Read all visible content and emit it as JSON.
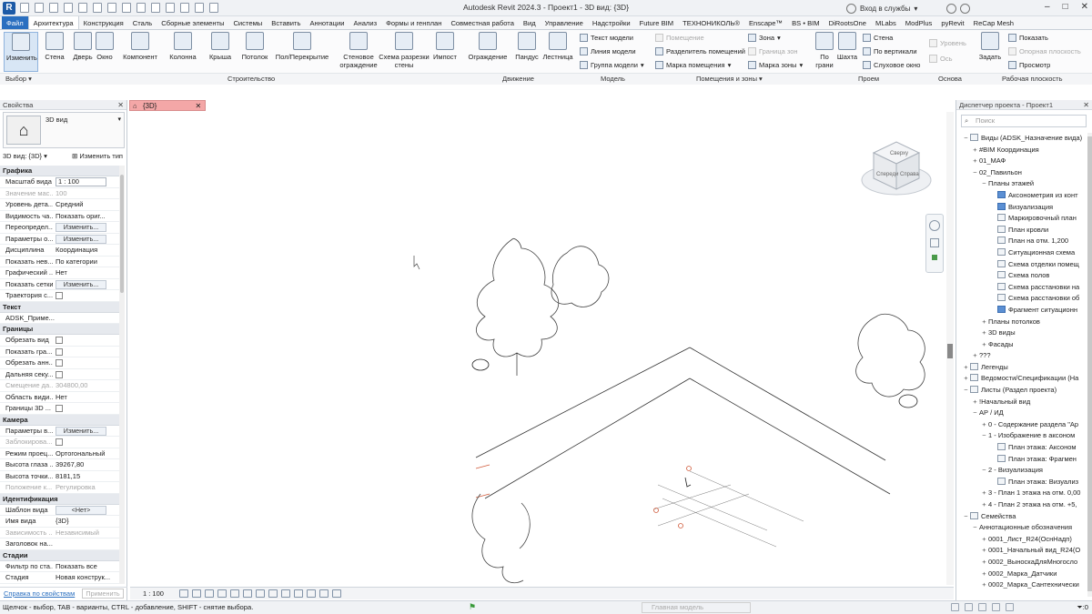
{
  "window": {
    "title": "Autodesk Revit 2024.3 - Проект1 - 3D вид: {3D}",
    "login": "Вход в службы",
    "app_logo": "R"
  },
  "tabs": [
    "Файл",
    "Архитектура",
    "Конструкция",
    "Сталь",
    "Сборные элементы",
    "Системы",
    "Вставить",
    "Аннотации",
    "Анализ",
    "Формы и генплан",
    "Совместная работа",
    "Вид",
    "Управление",
    "Надстройки",
    "Future BIM",
    "ТЕХНОНИКОЛЬ®",
    "Enscape™",
    "BS • BIM",
    "DiRootsOne",
    "MLabs",
    "ModPlus",
    "pyRevit",
    "ReCap Mesh"
  ],
  "ribbon": {
    "modify": "Изменить",
    "select": "Выбор",
    "build_buttons": [
      "Стена",
      "Дверь",
      "Окно",
      "Компонент",
      "Колонна",
      "Крыша",
      "Потолок",
      "Пол/Перекрытие",
      "Стеновое ограждение",
      "Схема разрезки стены",
      "Импост"
    ],
    "move_buttons": [
      "Ограждение",
      "Пандус",
      "Лестница"
    ],
    "model_items": [
      "Текст модели",
      "Линия модели",
      "Группа модели"
    ],
    "rooms_items": [
      "Помещение",
      "Разделитель помещений",
      "Марка помещения",
      "Зона",
      "Граница зон",
      "Марка зоны"
    ],
    "opening": {
      "face": "По грани",
      "shaft": "Шахта",
      "wall": "Стена",
      "vertical": "По вертикали",
      "dormer": "Слуховое окно"
    },
    "datum": {
      "level": "Уровень",
      "grid": "Ось"
    },
    "work_plane": {
      "set": "Задать",
      "show": "Показать",
      "ref_plane": "Опорная плоскость",
      "viewer": "Просмотр"
    },
    "panels": [
      "Выбор",
      "Строительство",
      "Движение",
      "Модель",
      "Помещения и зоны",
      "Проем",
      "Основа",
      "Рабочая плоскость"
    ]
  },
  "properties": {
    "title": "Свойства",
    "type_name": "3D вид",
    "selector": "3D вид: {3D}",
    "edit_type": "Изменить тип",
    "sections": [
      {
        "name": "Графика",
        "rows": [
          {
            "k": "Масштаб вида",
            "v": "1 : 100",
            "kind": "input"
          },
          {
            "k": "Значение мас...",
            "v": "100",
            "kind": "dim"
          },
          {
            "k": "Уровень дета...",
            "v": "Средний"
          },
          {
            "k": "Видимость ча...",
            "v": "Показать ориг..."
          },
          {
            "k": "Переопредел...",
            "v": "Изменить...",
            "kind": "button"
          },
          {
            "k": "Параметры о...",
            "v": "Изменить...",
            "kind": "button"
          },
          {
            "k": "Дисциплина",
            "v": "Координация"
          },
          {
            "k": "Показать нев...",
            "v": "По категории"
          },
          {
            "k": "Графический ...",
            "v": "Нет"
          },
          {
            "k": "Показать сетки",
            "v": "Изменить...",
            "kind": "button"
          },
          {
            "k": "Траектория с...",
            "v": "",
            "kind": "check"
          }
        ]
      },
      {
        "name": "Текст",
        "rows": [
          {
            "k": "ADSK_Приме...",
            "v": "",
            "kind": "full"
          }
        ]
      },
      {
        "name": "Границы",
        "rows": [
          {
            "k": "Обрезать вид",
            "v": "",
            "kind": "check"
          },
          {
            "k": "Показать гра...",
            "v": "",
            "kind": "check"
          },
          {
            "k": "Обрезать анн...",
            "v": "",
            "kind": "check"
          },
          {
            "k": "Дальняя секу...",
            "v": "",
            "kind": "check"
          },
          {
            "k": "Смещение да...",
            "v": "304800,00",
            "kind": "dim"
          },
          {
            "k": "Область види...",
            "v": "Нет"
          },
          {
            "k": "Границы 3D ...",
            "v": "",
            "kind": "check"
          }
        ]
      },
      {
        "name": "Камера",
        "rows": [
          {
            "k": "Параметры в...",
            "v": "Изменить...",
            "kind": "button"
          },
          {
            "k": "Заблокирова...",
            "v": "",
            "kind": "check",
            "dim": true
          },
          {
            "k": "Режим проец...",
            "v": "Ортогональный"
          },
          {
            "k": "Высота глаза ...",
            "v": "39267,80"
          },
          {
            "k": "Высота точки...",
            "v": "8181,15"
          },
          {
            "k": "Положение к...",
            "v": "Регулировка",
            "kind": "dim"
          }
        ]
      },
      {
        "name": "Идентификация",
        "rows": [
          {
            "k": "Шаблон вида",
            "v": "<Нет>",
            "kind": "button"
          },
          {
            "k": "Имя вида",
            "v": "{3D}"
          },
          {
            "k": "Зависимость ...",
            "v": "Независимый",
            "kind": "dim"
          },
          {
            "k": "Заголовок на...",
            "v": ""
          }
        ]
      },
      {
        "name": "Стадии",
        "rows": [
          {
            "k": "Фильтр по ста...",
            "v": "Показать все"
          },
          {
            "k": "Стадия",
            "v": "Новая конструк..."
          }
        ]
      }
    ],
    "help": "Справка по свойствам",
    "apply": "Применить"
  },
  "view_tab": {
    "label": "{3D}"
  },
  "view_control": {
    "scale": "1 : 100"
  },
  "viewcube": {
    "top": "Сверху",
    "front": "Спереди",
    "right": "Справа"
  },
  "browser": {
    "title": "Диспетчер проекта - Проект1",
    "search_placeholder": "Поиск",
    "items": [
      {
        "t": "Виды (ADSK_Назначение вида)",
        "lvl": 0,
        "tog": "−",
        "icon": "views-icon"
      },
      {
        "t": "#BIM Координация",
        "lvl": 1,
        "tog": "+"
      },
      {
        "t": "01_МАФ",
        "lvl": 1,
        "tog": "+"
      },
      {
        "t": "02_Павильон",
        "lvl": 1,
        "tog": "−"
      },
      {
        "t": "Планы этажей",
        "lvl": 2,
        "tog": "−"
      },
      {
        "t": "Аксонометрия из конт",
        "lvl": 3,
        "icon": "plan-icon",
        "blue": true
      },
      {
        "t": "Визуализация",
        "lvl": 3,
        "icon": "plan-icon",
        "blue": true
      },
      {
        "t": "Маркировочный план",
        "lvl": 3,
        "icon": "plan-icon"
      },
      {
        "t": "План кровли",
        "lvl": 3,
        "icon": "plan-icon"
      },
      {
        "t": "План на отм. 1,200",
        "lvl": 3,
        "icon": "plan-icon"
      },
      {
        "t": "Ситуационная схема",
        "lvl": 3,
        "icon": "plan-icon"
      },
      {
        "t": "Схема отделки помещ",
        "lvl": 3,
        "icon": "plan-icon"
      },
      {
        "t": "Схема полов",
        "lvl": 3,
        "icon": "plan-icon"
      },
      {
        "t": "Схема расстановки на",
        "lvl": 3,
        "icon": "plan-icon"
      },
      {
        "t": "Схема расстановки об",
        "lvl": 3,
        "icon": "plan-icon"
      },
      {
        "t": "Фрагмент ситуационн",
        "lvl": 3,
        "icon": "plan-icon",
        "blue": true
      },
      {
        "t": "Планы потолков",
        "lvl": 2,
        "tog": "+"
      },
      {
        "t": "3D виды",
        "lvl": 2,
        "tog": "+"
      },
      {
        "t": "Фасады",
        "lvl": 2,
        "tog": "+"
      },
      {
        "t": "???",
        "lvl": 1,
        "tog": "+"
      },
      {
        "t": "Легенды",
        "lvl": 0,
        "tog": "+",
        "icon": "legend-icon"
      },
      {
        "t": "Ведомости/Спецификации (На",
        "lvl": 0,
        "tog": "+",
        "icon": "schedule-icon"
      },
      {
        "t": "Листы (Раздел проекта)",
        "lvl": 0,
        "tog": "−",
        "icon": "sheet-icon"
      },
      {
        "t": "!Начальный вид",
        "lvl": 1,
        "tog": "+"
      },
      {
        "t": "АР / ИД",
        "lvl": 1,
        "tog": "−"
      },
      {
        "t": "0 - Содержание раздела \"Ар",
        "lvl": 2,
        "tog": "+"
      },
      {
        "t": "1 - Изображение в аксоном",
        "lvl": 2,
        "tog": "−"
      },
      {
        "t": "План этажа: Аксоном",
        "lvl": 3,
        "icon": "plan-icon"
      },
      {
        "t": "План этажа: Фрагмен",
        "lvl": 3,
        "icon": "plan-icon"
      },
      {
        "t": "2 - Визуализация",
        "lvl": 2,
        "tog": "−"
      },
      {
        "t": "План этажа: Визуализ",
        "lvl": 3,
        "icon": "plan-icon"
      },
      {
        "t": "3 - План 1 этажа на отм. 0,00",
        "lvl": 2,
        "tog": "+"
      },
      {
        "t": "4 - План 2 этажа на отм. +5,",
        "lvl": 2,
        "tog": "+"
      },
      {
        "t": "Семейства",
        "lvl": 0,
        "tog": "−",
        "icon": "family-icon"
      },
      {
        "t": "Аннотационные обозначения",
        "lvl": 1,
        "tog": "−"
      },
      {
        "t": "0001_Лист_R24(ОснНадп)",
        "lvl": 2,
        "tog": "+"
      },
      {
        "t": "0001_Начальный вид_R24(О",
        "lvl": 2,
        "tog": "+"
      },
      {
        "t": "0002_ВыноскаДляМногосло",
        "lvl": 2,
        "tog": "+"
      },
      {
        "t": "0002_Марка_Датчики",
        "lvl": 2,
        "tog": "+"
      },
      {
        "t": "0002_Марка_Сантехнически",
        "lvl": 2,
        "tog": "+"
      }
    ]
  },
  "status": {
    "hint": "Щелчок - выбор, TAB - варианты, CTRL - добавление, SHIFT - снятие выбора.",
    "model": "Главная модель",
    "filter": ":0"
  }
}
